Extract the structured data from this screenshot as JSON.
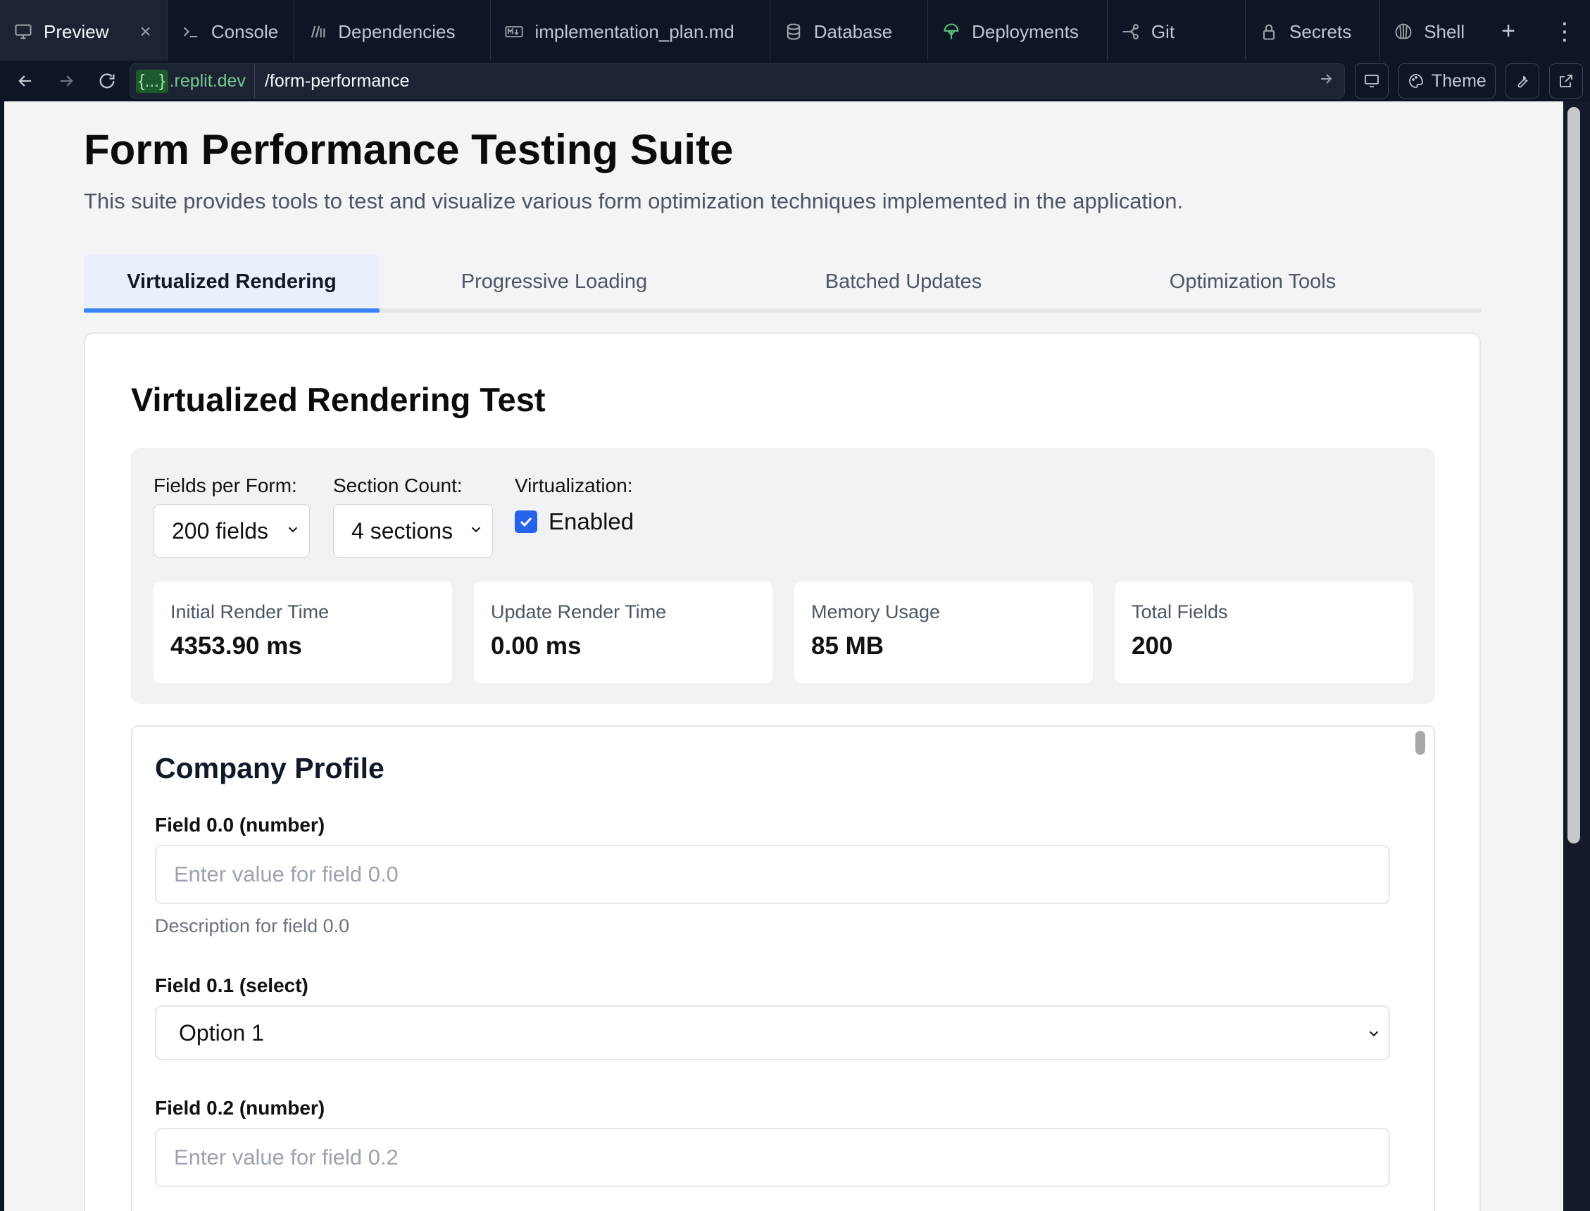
{
  "ide_tabs": [
    {
      "label": "Preview",
      "icon": "monitor-icon",
      "active": true
    },
    {
      "label": "Console",
      "icon": "terminal-icon"
    },
    {
      "label": "Dependencies",
      "icon": "package-icon"
    },
    {
      "label": "implementation_plan.md",
      "icon": "markdown-icon"
    },
    {
      "label": "Database",
      "icon": "database-icon"
    },
    {
      "label": "Deployments",
      "icon": "deploy-icon"
    },
    {
      "label": "Git",
      "icon": "git-icon"
    },
    {
      "label": "Secrets",
      "icon": "lock-icon"
    },
    {
      "label": "Shell",
      "icon": "shell-icon"
    }
  ],
  "tab_tools": {
    "new_tab": "+",
    "menu": "⋮"
  },
  "urlbar": {
    "host_brace": "{...}",
    "host_suffix": ".replit.dev",
    "path": "/form-performance",
    "theme_label": "Theme"
  },
  "page": {
    "title": "Form Performance Testing Suite",
    "description": "This suite provides tools to test and visualize various form optimization techniques implemented in the application.",
    "tabs": [
      "Virtualized Rendering",
      "Progressive Loading",
      "Batched Updates",
      "Optimization Tools"
    ],
    "active_tab": 0
  },
  "test": {
    "title": "Virtualized Rendering Test",
    "controls": {
      "fields_label": "Fields per Form:",
      "fields_value": "200 fields",
      "sections_label": "Section Count:",
      "sections_value": "4 sections",
      "virtualization_label": "Virtualization:",
      "virtualization_checkbox": "Enabled",
      "virtualization_checked": true
    },
    "metrics": [
      {
        "label": "Initial Render Time",
        "value": "4353.90 ms"
      },
      {
        "label": "Update Render Time",
        "value": "0.00 ms"
      },
      {
        "label": "Memory Usage",
        "value": "85 MB"
      },
      {
        "label": "Total Fields",
        "value": "200"
      }
    ]
  },
  "form": {
    "section_title": "Company Profile",
    "fields": [
      {
        "label": "Field 0.0 (number)",
        "placeholder": "Enter value for field 0.0",
        "description": "Description for field 0.0"
      },
      {
        "label": "Field 0.1 (select)",
        "value": "Option 1"
      },
      {
        "label": "Field 0.2 (number)",
        "placeholder": "Enter value for field 0.2"
      }
    ]
  },
  "colors": {
    "accent": "#3b82f6",
    "checkbox": "#2563eb",
    "ide_bg": "#0e1525",
    "page_bg": "#f3f4f6"
  }
}
